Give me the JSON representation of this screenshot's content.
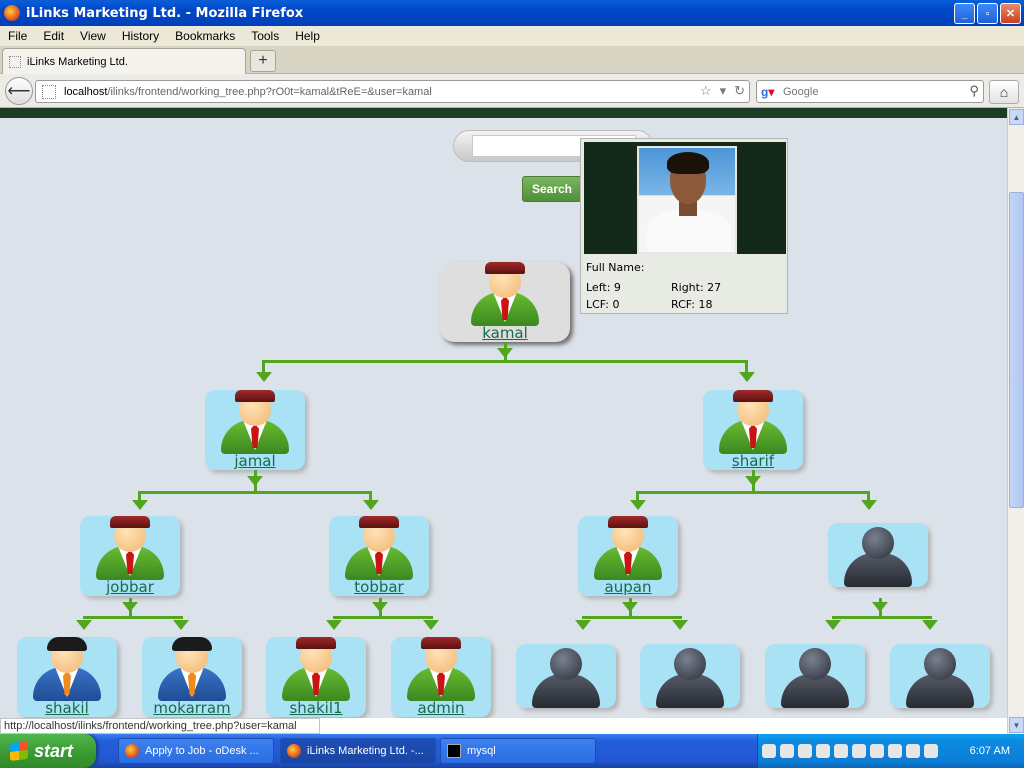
{
  "window": {
    "title": "iLinks Marketing Ltd. - Mozilla Firefox"
  },
  "menu": [
    "File",
    "Edit",
    "View",
    "History",
    "Bookmarks",
    "Tools",
    "Help"
  ],
  "tab": {
    "label": "iLinks Marketing Ltd.",
    "new_tab": "+"
  },
  "nav": {
    "url_host": "localhost",
    "url_path": "/ilinks/frontend/working_tree.php?rO0t=kamal&tReE=&user=kamal",
    "search_placeholder": "Google"
  },
  "page": {
    "search_button": "Search",
    "tooltip": {
      "full_name_label": "Full Name:",
      "left_label": "Left: 9",
      "right_label": "Right: 27",
      "lcf_label": "LCF: 0",
      "rcf_label": "RCF: 18"
    },
    "tree": {
      "root": "kamal",
      "level1": [
        "jamal",
        "sharif"
      ],
      "level2": [
        "jobbar",
        "tobbar",
        "aupan"
      ],
      "level3": [
        "shakil",
        "mokarram",
        "shakil1",
        "admin"
      ]
    }
  },
  "status": {
    "text": "http://localhost/ilinks/frontend/working_tree.php?user=kamal"
  },
  "taskbar": {
    "start": "start",
    "items": [
      "Apply to Job - oDesk ...",
      "iLinks Marketing Ltd. -...",
      "mysql"
    ],
    "clock": "6:07 AM"
  }
}
